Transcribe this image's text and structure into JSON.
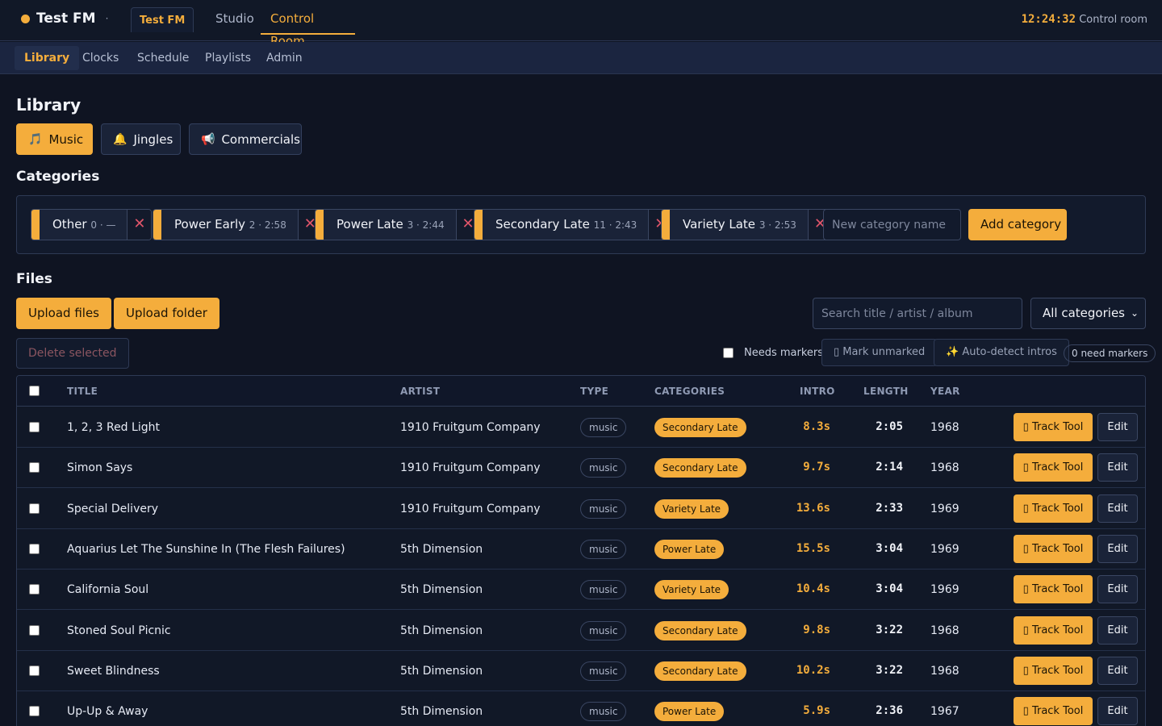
{
  "app": {
    "name": "Test FM",
    "separator": "·",
    "station_tab": "Test FM"
  },
  "mode_tabs": [
    {
      "label": "Studio"
    },
    {
      "label": "Control Room",
      "active": true
    }
  ],
  "clock": {
    "time": "12:24:32",
    "label": "Control room"
  },
  "nav": [
    {
      "label": "Library",
      "active": true
    },
    {
      "label": "Clocks"
    },
    {
      "label": "Schedule"
    },
    {
      "label": "Playlists"
    },
    {
      "label": "Admin"
    }
  ],
  "page_title": "Library",
  "type_buttons": [
    {
      "label": "Music",
      "icon": "music-note-icon",
      "active": true
    },
    {
      "label": "Jingles",
      "icon": "bell-icon"
    },
    {
      "label": "Commercials",
      "icon": "megaphone-icon"
    }
  ],
  "categories_title": "Categories",
  "categories": [
    {
      "name": "Other",
      "meta": "0 · —"
    },
    {
      "name": "Power Early",
      "meta": "2 · 2:58"
    },
    {
      "name": "Power Late",
      "meta": "3 · 2:44"
    },
    {
      "name": "Secondary Late",
      "meta": "11 · 2:43"
    },
    {
      "name": "Variety Late",
      "meta": "3 · 2:53"
    }
  ],
  "new_category_placeholder": "New category name",
  "add_category_label": "Add category",
  "files_title": "Files",
  "upload_files_label": "Upload files",
  "upload_folder_label": "Upload folder",
  "search_placeholder": "Search title / artist / album",
  "category_filter": "All categories",
  "delete_selected_label": "Delete selected",
  "needs_markers_label": "Needs markers",
  "mark_unmarked_label": "Mark unmarked",
  "auto_detect_label": "Auto-detect intros",
  "need_markers_count": "0 need markers",
  "columns": {
    "title": "TITLE",
    "artist": "ARTIST",
    "type": "TYPE",
    "categories": "CATEGORIES",
    "intro": "INTRO",
    "length": "LENGTH",
    "year": "YEAR"
  },
  "track_tool_label": "Track Tool",
  "edit_label": "Edit",
  "colors": {
    "accent": "#f4ad3c",
    "background": "#0f1422",
    "danger": "#e0556a"
  },
  "rows": [
    {
      "title": "1, 2, 3 Red Light",
      "artist": "1910 Fruitgum Company",
      "type": "music",
      "category": "Secondary Late",
      "intro": "8.3s",
      "length": "2:05",
      "year": "1968"
    },
    {
      "title": "Simon Says",
      "artist": "1910 Fruitgum Company",
      "type": "music",
      "category": "Secondary Late",
      "intro": "9.7s",
      "length": "2:14",
      "year": "1968"
    },
    {
      "title": "Special Delivery",
      "artist": "1910 Fruitgum Company",
      "type": "music",
      "category": "Variety Late",
      "intro": "13.6s",
      "length": "2:33",
      "year": "1969"
    },
    {
      "title": "Aquarius Let The Sunshine In (The Flesh Failures)",
      "artist": "5th Dimension",
      "type": "music",
      "category": "Power Late",
      "intro": "15.5s",
      "length": "3:04",
      "year": "1969"
    },
    {
      "title": "California Soul",
      "artist": "5th Dimension",
      "type": "music",
      "category": "Variety Late",
      "intro": "10.4s",
      "length": "3:04",
      "year": "1969"
    },
    {
      "title": "Stoned Soul Picnic",
      "artist": "5th Dimension",
      "type": "music",
      "category": "Secondary Late",
      "intro": "9.8s",
      "length": "3:22",
      "year": "1968"
    },
    {
      "title": "Sweet Blindness",
      "artist": "5th Dimension",
      "type": "music",
      "category": "Secondary Late",
      "intro": "10.2s",
      "length": "3:22",
      "year": "1968"
    },
    {
      "title": "Up-Up & Away",
      "artist": "5th Dimension",
      "type": "music",
      "category": "Power Late",
      "intro": "5.9s",
      "length": "2:36",
      "year": "1967"
    }
  ]
}
